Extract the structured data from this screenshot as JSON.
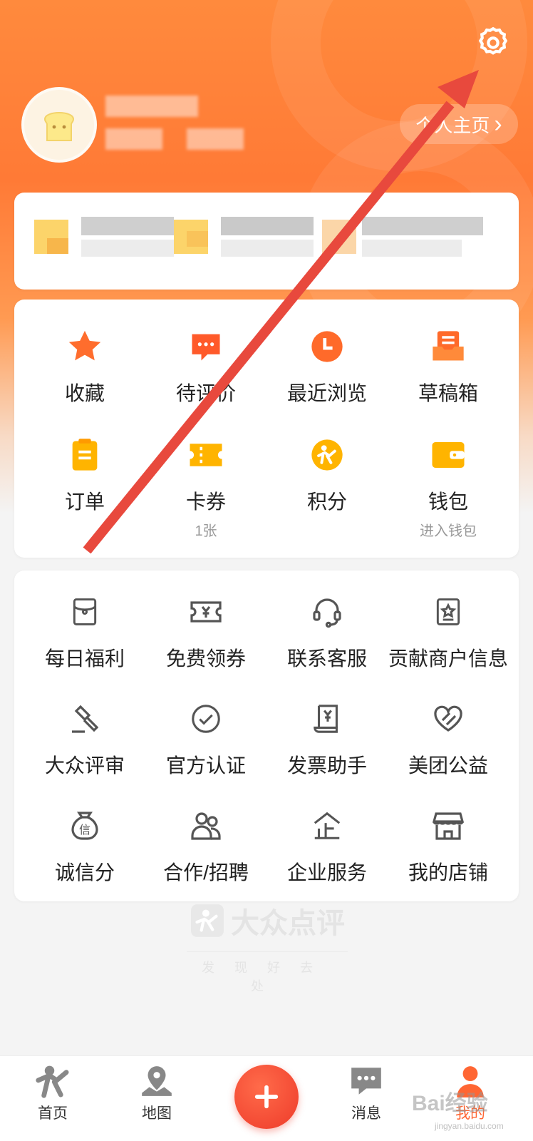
{
  "header": {
    "home_label": "个人主页",
    "home_chevron": "›"
  },
  "icons": {
    "settings": "gear-icon",
    "avatar": "toast-avatar-icon"
  },
  "colors": {
    "brand": "#ff6633",
    "accent": "#ff7a36",
    "arrow": "#e8493d"
  },
  "quick": [
    {
      "label": "收藏",
      "icon": "star-icon",
      "sub": ""
    },
    {
      "label": "待评价",
      "icon": "comment-icon",
      "sub": ""
    },
    {
      "label": "最近浏览",
      "icon": "clock-icon",
      "sub": ""
    },
    {
      "label": "草稿箱",
      "icon": "drafts-icon",
      "sub": ""
    },
    {
      "label": "订单",
      "icon": "order-icon",
      "sub": ""
    },
    {
      "label": "卡券",
      "icon": "ticket-icon",
      "sub": "1张"
    },
    {
      "label": "积分",
      "icon": "points-icon",
      "sub": ""
    },
    {
      "label": "钱包",
      "icon": "wallet-icon",
      "sub": "进入钱包"
    }
  ],
  "services": [
    {
      "label": "每日福利",
      "icon": "gift-envelope-icon"
    },
    {
      "label": "免费领券",
      "icon": "coupon-icon"
    },
    {
      "label": "联系客服",
      "icon": "headset-icon"
    },
    {
      "label": "贡献商户信息",
      "icon": "shop-star-icon"
    },
    {
      "label": "大众评审",
      "icon": "gavel-icon"
    },
    {
      "label": "官方认证",
      "icon": "check-circle-icon"
    },
    {
      "label": "发票助手",
      "icon": "invoice-icon"
    },
    {
      "label": "美团公益",
      "icon": "heart-icon"
    },
    {
      "label": "诚信分",
      "icon": "credit-icon"
    },
    {
      "label": "合作/招聘",
      "icon": "people-icon"
    },
    {
      "label": "企业服务",
      "icon": "enterprise-icon"
    },
    {
      "label": "我的店铺",
      "icon": "store-icon"
    }
  ],
  "brand": {
    "name": "大众点评",
    "slogan": "发现好去处"
  },
  "tabbar": {
    "home": "首页",
    "map": "地图",
    "messages": "消息",
    "me": "我的"
  },
  "watermark": {
    "site": "Bai经验",
    "url": "jingyan.baidu.com"
  }
}
